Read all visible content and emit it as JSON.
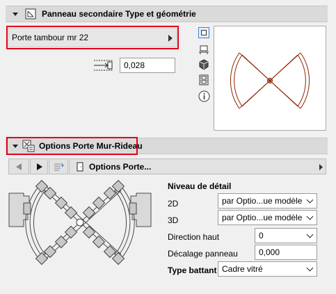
{
  "panel1": {
    "title": "Panneau secondaire Type et géométrie",
    "panel_type": "Porte tambour mr 22",
    "width_value": "0,028",
    "side_icons": [
      "square-view-icon",
      "floor-plan-icon",
      "cube-3d-icon",
      "film-strip-icon",
      "info-icon"
    ]
  },
  "panel2": {
    "title": "Options Porte Mur-Rideau",
    "nav_label": "Options Porte...",
    "detail_heading": "Niveau de détail",
    "rows": {
      "label_2d": "2D",
      "value_2d": "par Optio...ue modèle",
      "label_3d": "3D",
      "value_3d": "par Optio...ue modèle",
      "label_direction": "Direction haut",
      "value_direction": "0",
      "label_offset": "Décalage panneau",
      "value_offset": "0,000",
      "label_leaf": "Type battant",
      "value_leaf": "Cadre vitré"
    }
  },
  "colors": {
    "highlight_border": "#e2001a",
    "door_preview_stroke": "#8b2500",
    "header_bg": "#dadada",
    "selected_icon_border": "#3c7fd6"
  }
}
